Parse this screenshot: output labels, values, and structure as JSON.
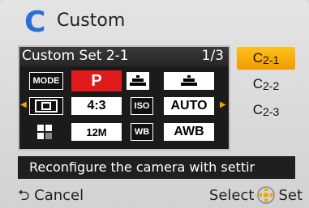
{
  "header": {
    "title": "Custom",
    "icon": "custom-c-icon",
    "accent": "#2a6fd6"
  },
  "panel": {
    "title": "Custom Set 2-1",
    "page": "1/3",
    "rows": [
      {
        "tag": "MODE",
        "value": "P",
        "icon1": "metering-icon",
        "icon2": "metering-multi-icon"
      },
      {
        "icon0": "af-area-icon",
        "value": "4:3",
        "tag2": "ISO",
        "value2": "AUTO"
      },
      {
        "icon0": "grid-icon",
        "value": "12M",
        "tag2": "WB",
        "value2": "AWB"
      }
    ]
  },
  "side": {
    "items": [
      {
        "label": "C",
        "sub": "2-1",
        "selected": true
      },
      {
        "label": "C",
        "sub": "2-2",
        "selected": false
      },
      {
        "label": "C",
        "sub": "2-3",
        "selected": false
      }
    ],
    "accent": "#f0a800"
  },
  "description": "Reconfigure the camera with settir",
  "footer": {
    "cancel": "Cancel",
    "select": "Select",
    "set": "Set"
  }
}
